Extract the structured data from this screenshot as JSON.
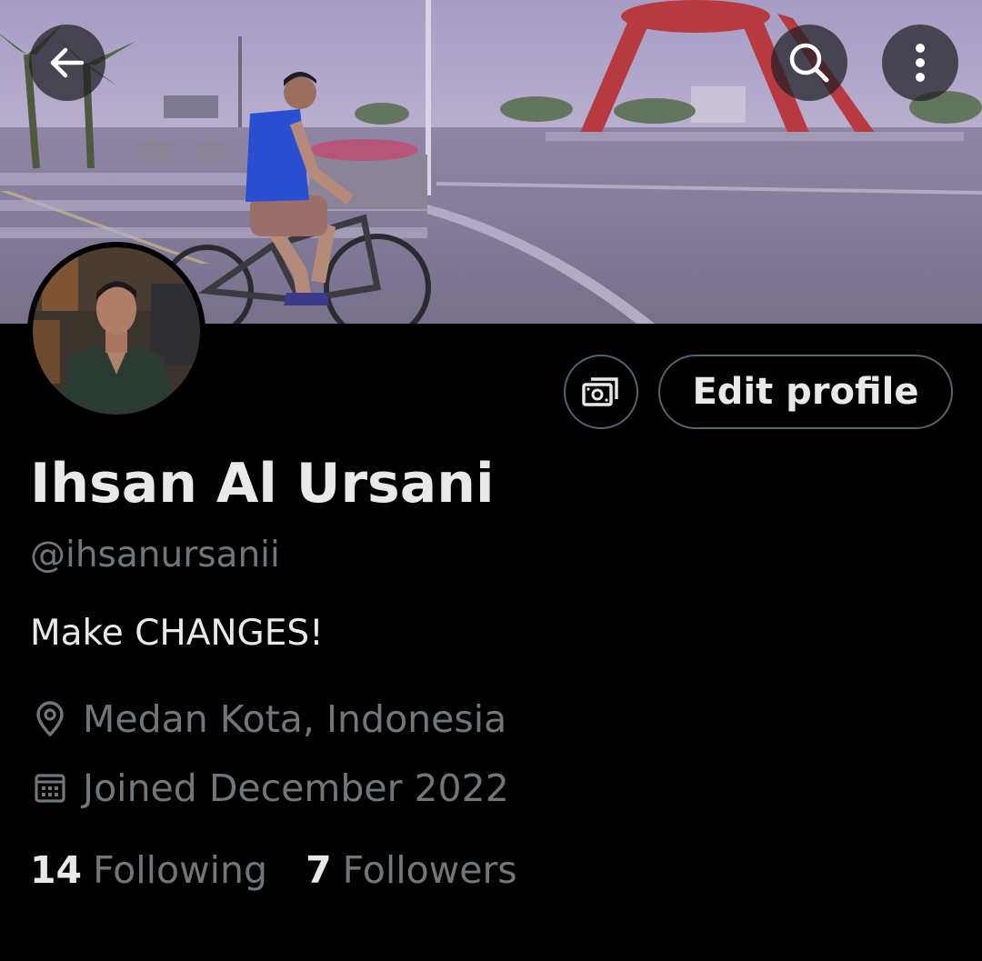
{
  "header": {
    "back_icon": "arrow-left-icon",
    "search_icon": "search-icon",
    "more_icon": "more-vertical-icon"
  },
  "profile": {
    "display_name": "Ihsan Al Ursani",
    "handle": "@ihsanursanii",
    "bio": "Make CHANGES!",
    "location": "Medan Kota, Indonesia",
    "joined": "Joined December 2022",
    "location_icon": "location-pin-icon",
    "joined_icon": "calendar-icon"
  },
  "actions": {
    "monetization_icon": "money-icon",
    "edit_profile_label": "Edit profile"
  },
  "stats": {
    "following_count": "14",
    "following_label": "Following",
    "followers_count": "7",
    "followers_label": "Followers"
  },
  "colors": {
    "background": "#000000",
    "primary_text": "#e7e9ea",
    "secondary_text": "#71767b",
    "border": "#536471"
  }
}
